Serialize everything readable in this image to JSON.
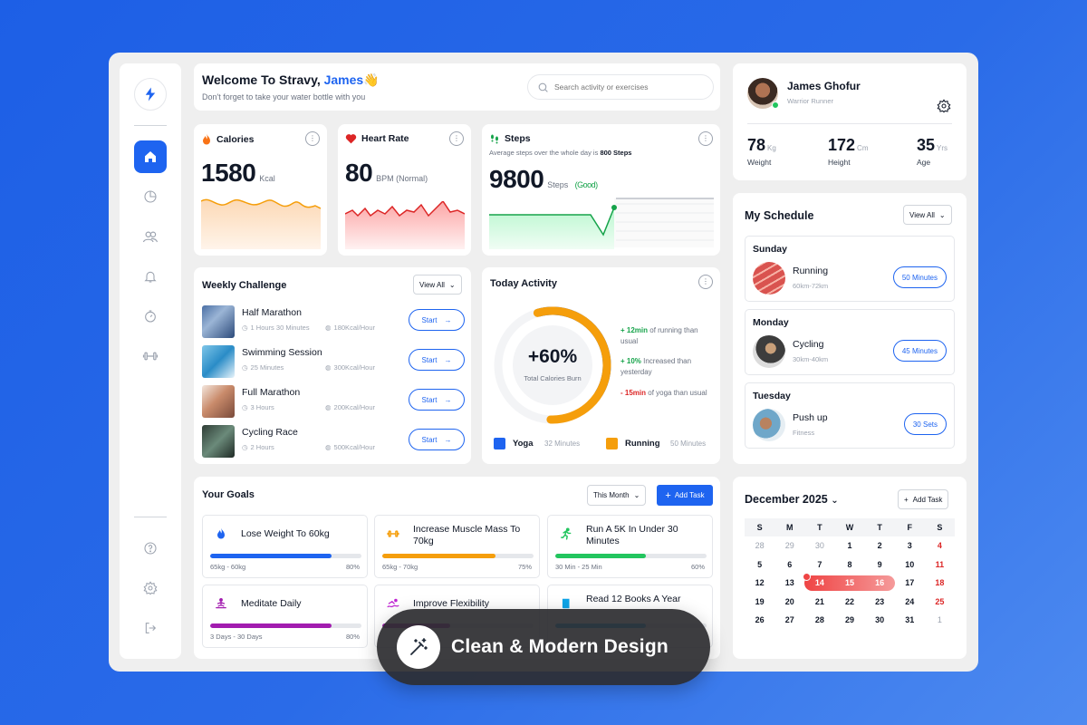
{
  "welcome": {
    "greeting": "Welcome To Stravy, ",
    "name": "James👋",
    "subtitle": "Don't forget to take your water bottle with you"
  },
  "search": {
    "placeholder": "Search activity or exercises"
  },
  "calories": {
    "title": "Calories",
    "value": "1580",
    "unit": "Kcal"
  },
  "heart_rate": {
    "title": "Heart Rate",
    "value": "80",
    "unit": "BPM (Normal)"
  },
  "steps": {
    "title": "Steps",
    "subtitle_prefix": "Average steps over the whole day is ",
    "subtitle_value": "800 Steps",
    "value": "9800",
    "unit": "Steps",
    "status": "(Good)"
  },
  "profile": {
    "name": "James Ghofur",
    "role": "Warrior Runner",
    "stats": [
      {
        "value": "78",
        "unit": "Kg",
        "label": "Weight"
      },
      {
        "value": "172",
        "unit": "Cm",
        "label": "Height"
      },
      {
        "value": "35",
        "unit": "Yrs",
        "label": "Age"
      }
    ]
  },
  "weekly": {
    "title": "Weekly Challenge",
    "view_all": "View All",
    "start_label": "Start",
    "items": [
      {
        "name": "Half Marathon",
        "time": "1 Hours 30 Minutes",
        "kcal": "180Kcal/Hour"
      },
      {
        "name": "Swimming Session",
        "time": "25 Minutes",
        "kcal": "300Kcal/Hour"
      },
      {
        "name": "Full Marathon",
        "time": "3 Hours",
        "kcal": "200Kcal/Hour"
      },
      {
        "name": "Cycling Race",
        "time": "2 Hours",
        "kcal": "500Kcal/Hour"
      }
    ]
  },
  "today": {
    "title": "Today Activity",
    "center_value": "+60%",
    "center_label": "Total Calories Burn",
    "yoga_fraction": 0.38,
    "running_fraction": 0.55,
    "notes": [
      {
        "value": "+ 12min",
        "text": " of running than usual",
        "color": "#16a34a"
      },
      {
        "value": "+ 10%",
        "text": " Increased than yesterday",
        "color": "#16a34a"
      },
      {
        "value": "- 15min",
        "text": " of yoga than usual",
        "color": "#dc2626"
      }
    ],
    "legend": [
      {
        "label": "Yoga",
        "minutes": "32 Minutes",
        "color": "#1e64f0"
      },
      {
        "label": "Running",
        "minutes": "50 Minutes",
        "color": "#f59e0b"
      }
    ]
  },
  "schedule": {
    "title": "My Schedule",
    "view_all": "View All",
    "items": [
      {
        "day": "Sunday",
        "activity": "Running",
        "detail": "60km-72km",
        "action": "50 Minutes"
      },
      {
        "day": "Monday",
        "activity": "Cycling",
        "detail": "30km-40km",
        "action": "45 Minutes"
      },
      {
        "day": "Tuesday",
        "activity": "Push up",
        "detail": "Fitness",
        "action": "30 Sets"
      }
    ]
  },
  "goals": {
    "title": "Your Goals",
    "period": "This Month",
    "add_task": "Add Task",
    "items": [
      {
        "title": "Lose Weight To 60kg",
        "range": "65kg - 60kg",
        "percent": "80%",
        "progress": 0.8,
        "color": "#1e64f0",
        "icon": "fire-icon"
      },
      {
        "title": "Increase Muscle Mass To 70kg",
        "range": "65kg - 70kg",
        "percent": "75%",
        "progress": 0.75,
        "color": "#f59e0b",
        "icon": "dumbbell-icon"
      },
      {
        "title": "Run A 5K In Under 30 Minutes",
        "range": "30 Min - 25 Min",
        "percent": "60%",
        "progress": 0.6,
        "color": "#22c55e",
        "icon": "runner-icon"
      },
      {
        "title": "Meditate Daily",
        "range": "3 Days - 30 Days",
        "percent": "80%",
        "progress": 0.8,
        "color": "#a21caf",
        "icon": "meditation-icon"
      },
      {
        "title": "Improve Flexibility",
        "range": "",
        "percent": "",
        "progress": 0.45,
        "color": "#a21caf",
        "icon": "swim-icon"
      },
      {
        "title": "Read 12 Books A Year",
        "range": "",
        "percent": "",
        "progress": 0.6,
        "color": "#0ea5e9",
        "icon": "book-icon"
      }
    ]
  },
  "calendar": {
    "month": "December 2025",
    "add_task": "Add Task",
    "weekdays": [
      "S",
      "M",
      "T",
      "W",
      "T",
      "F",
      "S"
    ],
    "weeks": [
      [
        "28",
        "29",
        "30",
        "1",
        "2",
        "3",
        "4"
      ],
      [
        "5",
        "6",
        "7",
        "8",
        "9",
        "10",
        "11"
      ],
      [
        "12",
        "13",
        "14",
        "15",
        "16",
        "17",
        "18"
      ],
      [
        "19",
        "20",
        "21",
        "22",
        "23",
        "24",
        "25"
      ],
      [
        "26",
        "27",
        "28",
        "29",
        "30",
        "31",
        "1"
      ]
    ]
  },
  "banner": {
    "text": "Clean & Modern Design"
  }
}
